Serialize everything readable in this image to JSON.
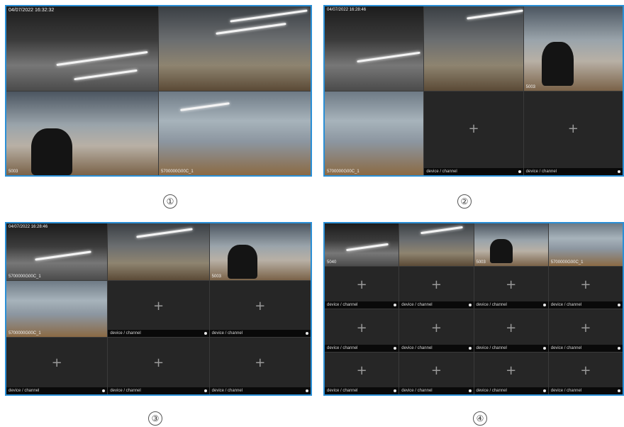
{
  "accent_color": "#2a8fd6",
  "layouts": [
    {
      "marker": "①",
      "cameras": [
        {
          "osd": "04/07/2022  16:32:32",
          "label": ""
        },
        {
          "osd": "",
          "label": ""
        },
        {
          "osd": "",
          "label": "5003"
        },
        {
          "osd": "",
          "label": "5700000G00C_1"
        }
      ]
    },
    {
      "marker": "②",
      "cameras": [
        {
          "osd": "04/07/2022  16:28:46",
          "label": ""
        },
        {
          "osd": "",
          "label": ""
        },
        {
          "osd": "",
          "label": "5003"
        },
        {
          "osd": "",
          "label": "5700000G00C_1"
        }
      ],
      "empty_label": "device / channel"
    },
    {
      "marker": "③",
      "cameras": [
        {
          "osd": "04/07/2022  16:28:46",
          "label": "5700000G00C_1"
        },
        {
          "osd": "",
          "label": ""
        },
        {
          "osd": "",
          "label": "5003"
        },
        {
          "osd": "",
          "label": "5700000G00C_1"
        }
      ],
      "empty_label": "device / channel"
    },
    {
      "marker": "④",
      "cameras": [
        {
          "osd": "",
          "label": "5040"
        },
        {
          "osd": "",
          "label": ""
        },
        {
          "osd": "",
          "label": "5003"
        },
        {
          "osd": "",
          "label": "5700000G00C_1"
        }
      ],
      "empty_label": "device / channel"
    }
  ]
}
